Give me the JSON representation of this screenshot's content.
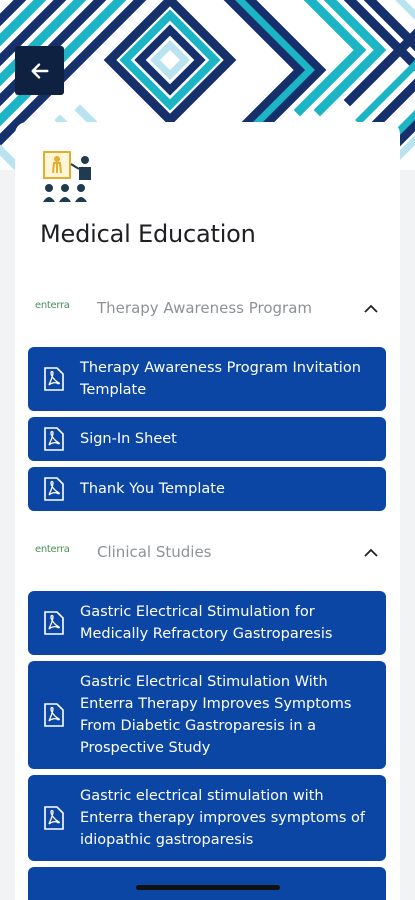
{
  "header": {
    "back_icon": "arrow-left-icon",
    "hero_icon": "medical-education-presenter-icon",
    "title": "Medical Education"
  },
  "colors": {
    "accent": "#0b46a5",
    "back_button": "#0f2140",
    "pattern_navy": "#16306b",
    "pattern_teal": "#1bb5c5",
    "pattern_light": "#b9e4ef"
  },
  "sections": [
    {
      "logo_text": "enterra",
      "title": "Therapy Awareness Program",
      "chevron": "chevron-up-icon",
      "items": [
        {
          "label": "Therapy Awareness Program Invitation Template",
          "icon": "pdf-icon"
        },
        {
          "label": "Sign-In Sheet",
          "icon": "pdf-icon"
        },
        {
          "label": "Thank You Template",
          "icon": "pdf-icon"
        }
      ]
    },
    {
      "logo_text": "enterra",
      "title": "Clinical Studies",
      "chevron": "chevron-up-icon",
      "items": [
        {
          "label": "Gastric Electrical Stimulation for Medically Refractory Gastroparesis",
          "icon": "pdf-icon"
        },
        {
          "label": "Gastric Electrical Stimulation With Enterra Therapy Improves Symptoms From Diabetic Gastroparesis in a Prospective Study",
          "icon": "pdf-icon"
        },
        {
          "label": "Gastric electrical stimulation with Enterra therapy improves symptoms of idiopathic gastroparesis",
          "icon": "pdf-icon"
        }
      ]
    }
  ]
}
